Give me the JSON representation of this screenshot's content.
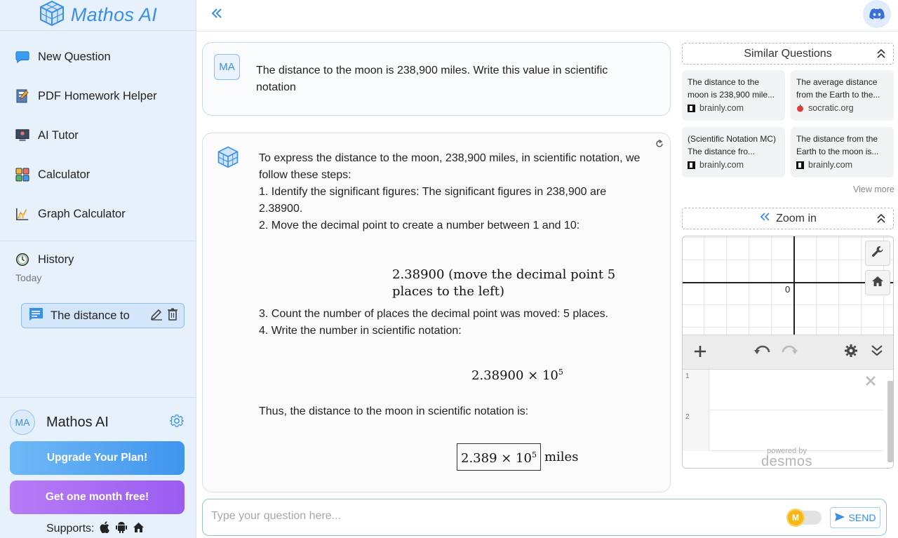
{
  "brand": {
    "name": "Mathos AI"
  },
  "sidebar": {
    "items": [
      {
        "label": "New Question",
        "icon": "chat-bubble-icon"
      },
      {
        "label": "PDF Homework Helper",
        "icon": "pdf-book-icon"
      },
      {
        "label": "AI Tutor",
        "icon": "tutor-board-icon"
      },
      {
        "label": "Calculator",
        "icon": "calculator-icon"
      },
      {
        "label": "Graph Calculator",
        "icon": "graph-icon"
      }
    ],
    "history_label": "History",
    "today_label": "Today",
    "history_items": [
      {
        "label": "The distance to"
      }
    ]
  },
  "user": {
    "avatar": "MA",
    "name": "Mathos AI"
  },
  "buttons": {
    "upgrade": "Upgrade Your Plan!",
    "free": "Get one month free!"
  },
  "supports_label": "Supports:",
  "question": {
    "avatar": "MA",
    "text": "The distance to the moon is 238,900 miles. Write this value in scientific notation"
  },
  "answer": {
    "intro": "To express the distance to the moon, 238,900 miles, in scientific notation, we follow these steps:",
    "step1": "1. Identify the significant figures: The significant figures in 238,900 are 2.38900.",
    "step2": "2. Move the decimal point to create a number between 1 and 10:",
    "math1": "2.38900 (move the decimal point 5 places to the left)",
    "step3": "3. Count the number of places the decimal point was moved: 5 places.",
    "step4": "4. Write the number in scientific notation:",
    "math2_base": "2.38900 × 10",
    "math2_exp": "5",
    "conclusion": "Thus, the distance to the moon in scientific notation is:",
    "final_base": "2.389 × 10",
    "final_exp": "5",
    "final_unit": "miles"
  },
  "input": {
    "placeholder": "Type your question here...",
    "send_label": "SEND",
    "coin_label": "M"
  },
  "similar": {
    "title": "Similar Questions",
    "cards": [
      {
        "title": "The distance to the moon is 238,900 mile...",
        "source": "brainly.com"
      },
      {
        "title": "The average distance from the Earth to the...",
        "source": "socratic.org"
      },
      {
        "title": "(Scientific Notation MC) The distance fro...",
        "source": "brainly.com"
      },
      {
        "title": "The distance from the Earth to the moon is...",
        "source": "brainly.com"
      }
    ],
    "view_more": "View more"
  },
  "zoom": {
    "label": "Zoom in"
  },
  "calculator": {
    "origin_label": "0",
    "expr_rows": [
      "1",
      "2"
    ],
    "powered_by": "powered by",
    "brand": "desmos"
  },
  "colors": {
    "accent": "#3a8ee6",
    "sidebar_bg": "#e6f1fb",
    "upgrade": "#4a9cf0",
    "free": "#a86cf3"
  }
}
